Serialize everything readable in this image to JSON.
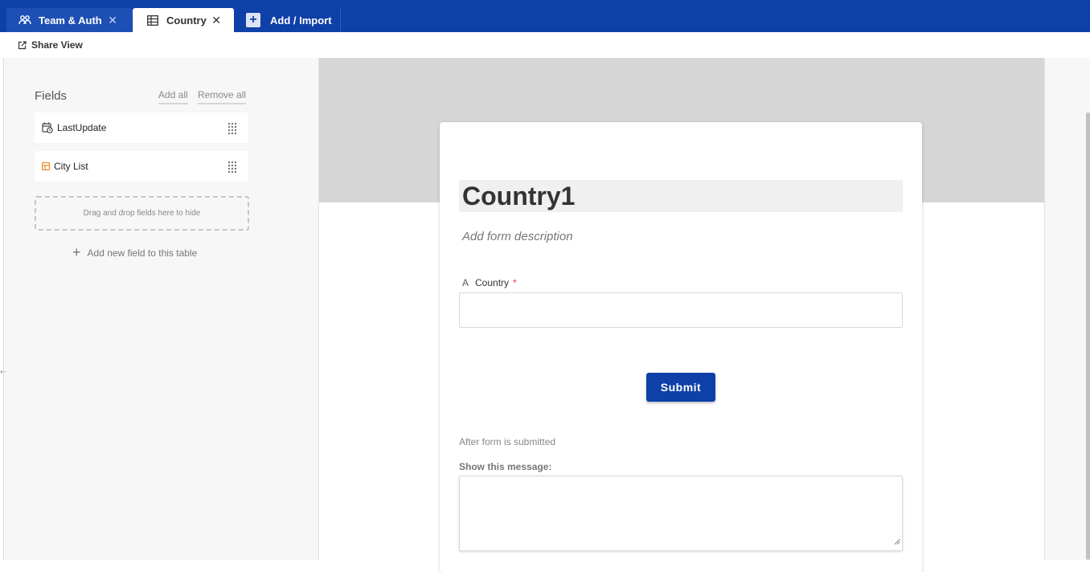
{
  "tabs": [
    {
      "label": "Team & Auth",
      "icon": "team-icon",
      "closable": true
    },
    {
      "label": "Country",
      "icon": "grid-icon",
      "closable": true,
      "active": true
    },
    {
      "label": "Add / Import",
      "icon": "plus-icon"
    }
  ],
  "toolbar": {
    "share_label": "Share View",
    "share_icon": "external-link-icon"
  },
  "fields_panel": {
    "title": "Fields",
    "add_all": "Add all",
    "remove_all": "Remove all",
    "fields": [
      {
        "label": "LastUpdate",
        "icon": "calendar-clock-icon"
      },
      {
        "label": "City List",
        "icon": "link-table-icon"
      }
    ],
    "dropzone_text": "Drag and drop fields here to hide",
    "add_field_label": "Add new field to this table"
  },
  "form": {
    "title": "Country1",
    "description_placeholder": "Add form description",
    "question": {
      "label": "Country",
      "type_icon": "text-type-icon",
      "required": "*",
      "value": ""
    },
    "submit_label": "Submit",
    "after_submit_label": "After form is submitted",
    "show_message_label": "Show this message:",
    "message_value": ""
  },
  "colors": {
    "brand": "#0f40a8",
    "required": "#e0383e"
  }
}
